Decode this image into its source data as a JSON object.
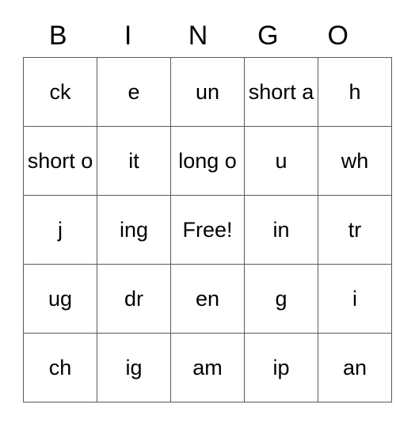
{
  "card": {
    "headers": [
      "B",
      "I",
      "N",
      "G",
      "O"
    ],
    "rows": [
      [
        {
          "text": "ck",
          "wrap": false,
          "free": false
        },
        {
          "text": "e",
          "wrap": false,
          "free": false
        },
        {
          "text": "un",
          "wrap": false,
          "free": false
        },
        {
          "text": "short a",
          "wrap": true,
          "free": false
        },
        {
          "text": "h",
          "wrap": false,
          "free": false
        }
      ],
      [
        {
          "text": "short o",
          "wrap": true,
          "free": false
        },
        {
          "text": "it",
          "wrap": false,
          "free": false
        },
        {
          "text": "long o",
          "wrap": true,
          "free": false
        },
        {
          "text": "u",
          "wrap": false,
          "free": false
        },
        {
          "text": "wh",
          "wrap": false,
          "free": false
        }
      ],
      [
        {
          "text": "j",
          "wrap": false,
          "free": false
        },
        {
          "text": "ing",
          "wrap": false,
          "free": false
        },
        {
          "text": "Free!",
          "wrap": false,
          "free": true
        },
        {
          "text": "in",
          "wrap": false,
          "free": false
        },
        {
          "text": "tr",
          "wrap": false,
          "free": false
        }
      ],
      [
        {
          "text": "ug",
          "wrap": false,
          "free": false
        },
        {
          "text": "dr",
          "wrap": false,
          "free": false
        },
        {
          "text": "en",
          "wrap": false,
          "free": false
        },
        {
          "text": "g",
          "wrap": false,
          "free": false
        },
        {
          "text": "i",
          "wrap": false,
          "free": false
        }
      ],
      [
        {
          "text": "ch",
          "wrap": false,
          "free": false
        },
        {
          "text": "ig",
          "wrap": false,
          "free": false
        },
        {
          "text": "am",
          "wrap": false,
          "free": false
        },
        {
          "text": "ip",
          "wrap": false,
          "free": false
        },
        {
          "text": "an",
          "wrap": false,
          "free": false
        }
      ]
    ],
    "colors": {
      "border": "#5a5a5a",
      "text": "#000000",
      "background": "#ffffff"
    }
  }
}
